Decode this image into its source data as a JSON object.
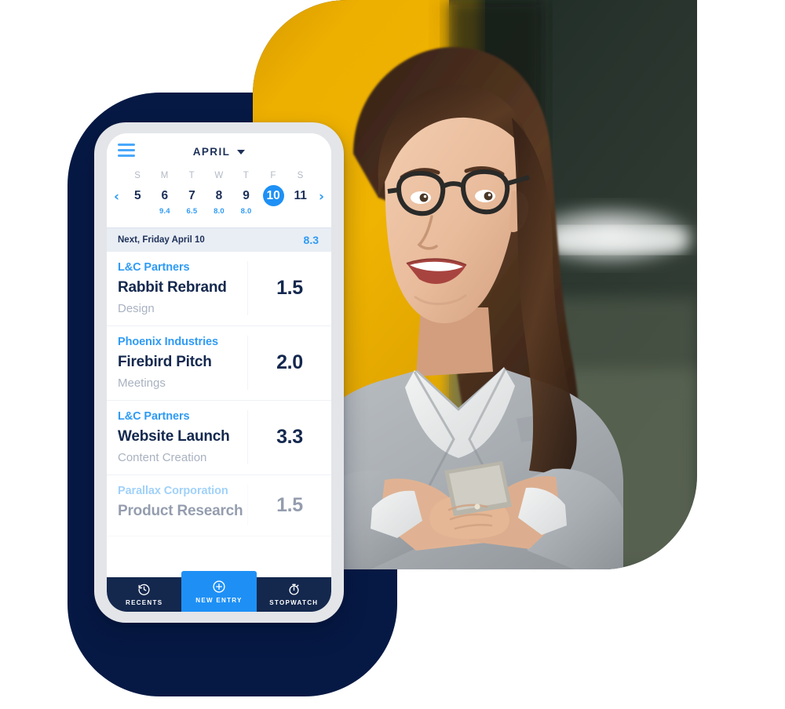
{
  "app": {
    "header": {
      "menu_icon": "hamburger-menu-icon",
      "month": "APRIL",
      "dropdown_icon": "chevron-down-icon"
    },
    "calendar": {
      "prev_icon": "chevron-left-icon",
      "next_icon": "chevron-right-icon",
      "weekday_labels": [
        "S",
        "M",
        "T",
        "W",
        "T",
        "F",
        "S"
      ],
      "days": [
        {
          "number": "5",
          "hours": "",
          "selected": false
        },
        {
          "number": "6",
          "hours": "9.4",
          "selected": false
        },
        {
          "number": "7",
          "hours": "6.5",
          "selected": false
        },
        {
          "number": "8",
          "hours": "8.0",
          "selected": false
        },
        {
          "number": "9",
          "hours": "8.0",
          "selected": false
        },
        {
          "number": "10",
          "hours": "",
          "selected": true
        },
        {
          "number": "11",
          "hours": "",
          "selected": false
        }
      ]
    },
    "summary": {
      "label": "Next, Friday April 10",
      "total": "8.3"
    },
    "entries": [
      {
        "client": "L&C Partners",
        "task": "Rabbit Rebrand",
        "category": "Design",
        "hours": "1.5"
      },
      {
        "client": "Phoenix Industries",
        "task": "Firebird Pitch",
        "category": "Meetings",
        "hours": "2.0"
      },
      {
        "client": "L&C Partners",
        "task": "Website Launch",
        "category": "Content Creation",
        "hours": "3.3"
      },
      {
        "client": "Parallax Corporation",
        "task": "Product Research",
        "category": "",
        "hours": "1.5"
      }
    ],
    "tabs": [
      {
        "label": "RECENTS",
        "icon": "clock-rewind-icon",
        "active": false
      },
      {
        "label": "NEW ENTRY",
        "icon": "plus-circle-icon",
        "active": true
      },
      {
        "label": "STOPWATCH",
        "icon": "stopwatch-icon",
        "active": false
      }
    ]
  },
  "colors": {
    "accent_blue": "#1E90F5",
    "light_blue": "#2F9BF5",
    "navy": "#14284E",
    "deep_navy": "#061944",
    "yellow": "#E9A900",
    "summary_bg": "#E9EEF5",
    "phone_frame": "#E3E5E9",
    "muted_text": "#A9B2C1"
  },
  "photo": {
    "alt": "Smiling woman with glasses in grey blazer holding a phone",
    "backdrop_left": "#E9A900",
    "backdrop_right": "#1d2220"
  }
}
